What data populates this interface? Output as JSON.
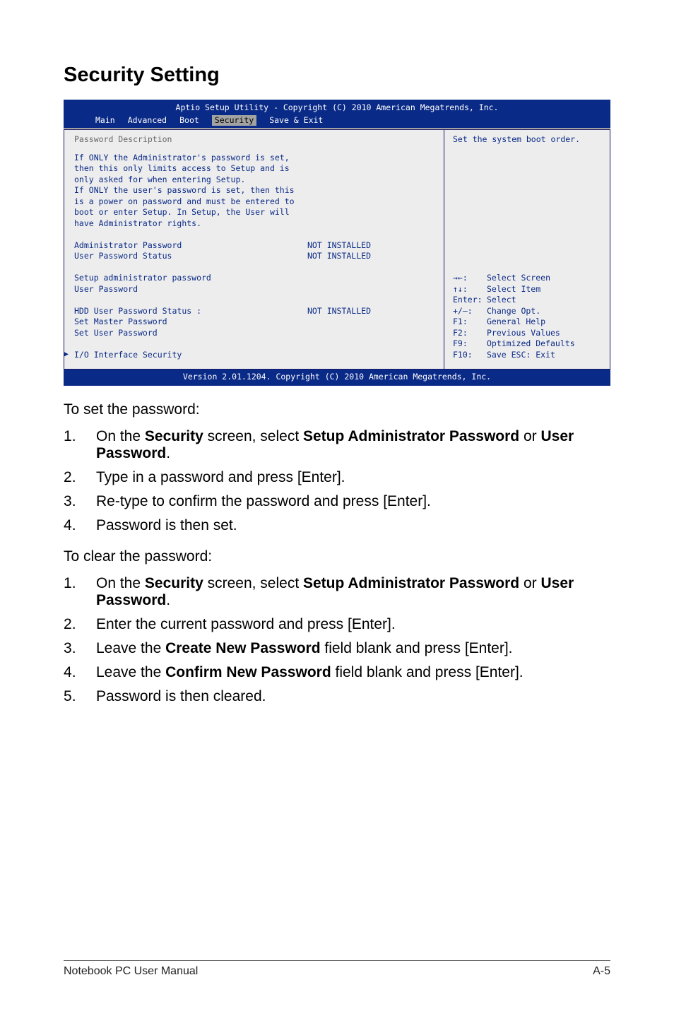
{
  "heading": "Security Setting",
  "bios": {
    "title_bar": "Aptio Setup Utility - Copyright (C) 2010 American Megatrends, Inc.",
    "tabs": [
      "Main",
      "Advanced",
      "Boot",
      "Security",
      "Save & Exit"
    ],
    "section_title": "Password Description",
    "body_lines": [
      "If ONLY the Administrator's password is set,",
      "then this only limits access to Setup and is",
      "only asked for when entering Setup.",
      "If ONLY the user's password is set, then this",
      "is a power on password and must be entered to",
      "boot or enter Setup. In Setup, the User will",
      "have Administrator rights."
    ],
    "rows": {
      "admin_pw_label": "Administrator Password",
      "admin_pw_val": "NOT INSTALLED",
      "user_pw_status_label": "User Password Status",
      "user_pw_status_val": "NOT INSTALLED",
      "setup_admin_pw": "Setup administrator password",
      "user_pw": "User Password",
      "hdd_user_pw_status_label": "HDD User Password Status  :",
      "hdd_user_pw_status_val": "NOT INSTALLED",
      "set_master_pw": "Set Master Password",
      "set_user_pw": "Set User Password"
    },
    "io_security": "I/O Interface Security",
    "right_top": "Set the system boot order.",
    "help": {
      "r1_key": "→←:",
      "r1_txt": "Select Screen",
      "r2_key": "↑↓:",
      "r2_txt": "Select Item",
      "r3_key": "Enter:",
      "r3_txt": "Select",
      "r4_key": "+/—:",
      "r4_txt": "Change Opt.",
      "r5_key": "F1:",
      "r5_txt": "General Help",
      "r6_key": "F2:",
      "r6_txt": "Previous Values",
      "r7_key": "F9:",
      "r7_txt": "Optimized Defaults",
      "r8_key": "F10:",
      "r8_txt": "Save   ESC: Exit"
    },
    "footer": "Version 2.01.1204. Copyright (C) 2010 American Megatrends, Inc."
  },
  "set_pw_intro": "To set the password:",
  "set_pw_steps": {
    "s1a": "On the ",
    "s1b": "Security",
    "s1c": " screen, select ",
    "s1d": "Setup Administrator Password",
    "s1e": " or ",
    "s1f": "User Password",
    "s1g": ".",
    "s2": "Type in a password and press [Enter].",
    "s3": "Re-type to confirm the password and press [Enter].",
    "s4": "Password is then set."
  },
  "clear_pw_intro": "To clear the password:",
  "clear_pw_steps": {
    "s1a": "On the ",
    "s1b": "Security",
    "s1c": " screen, select ",
    "s1d": "Setup Administrator Password",
    "s1e": " or ",
    "s1f": "User Password",
    "s1g": ".",
    "s2": "Enter the current password and press [Enter].",
    "s3a": "Leave the ",
    "s3b": "Create New Password",
    "s3c": " field blank and press [Enter].",
    "s4a": "Leave the ",
    "s4b": "Confirm New Password",
    "s4c": " field blank and press [Enter].",
    "s5": "Password is then cleared."
  },
  "footer_left": "Notebook PC User Manual",
  "footer_right": "A-5"
}
